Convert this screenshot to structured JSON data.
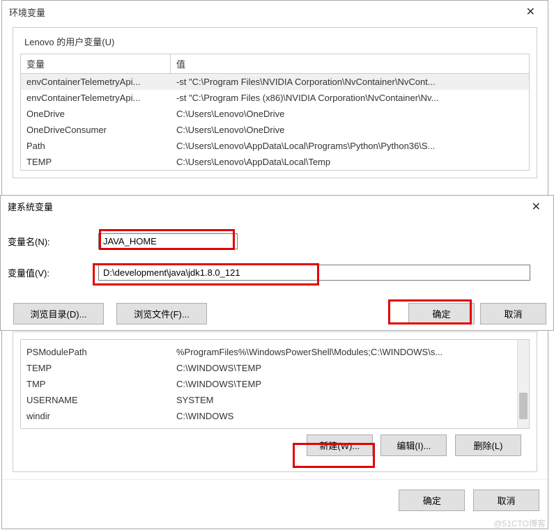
{
  "envDialog": {
    "title": "环境变量",
    "userGroup": "Lenovo 的用户变量(U)",
    "colVar": "变量",
    "colVal": "值",
    "userVars": [
      {
        "name": "envContainerTelemetryApi...",
        "value": "-st \"C:\\Program Files\\NVIDIA Corporation\\NvContainer\\NvCont..."
      },
      {
        "name": "envContainerTelemetryApi...",
        "value": "-st \"C:\\Program Files (x86)\\NVIDIA Corporation\\NvContainer\\Nv..."
      },
      {
        "name": "OneDrive",
        "value": "C:\\Users\\Lenovo\\OneDrive"
      },
      {
        "name": "OneDriveConsumer",
        "value": "C:\\Users\\Lenovo\\OneDrive"
      },
      {
        "name": "Path",
        "value": "C:\\Users\\Lenovo\\AppData\\Local\\Programs\\Python\\Python36\\S..."
      },
      {
        "name": "TEMP",
        "value": "C:\\Users\\Lenovo\\AppData\\Local\\Temp"
      }
    ],
    "sysVars": [
      {
        "name": "PSModulePath",
        "value": "%ProgramFiles%\\WindowsPowerShell\\Modules;C:\\WINDOWS\\s..."
      },
      {
        "name": "TEMP",
        "value": "C:\\WINDOWS\\TEMP"
      },
      {
        "name": "TMP",
        "value": "C:\\WINDOWS\\TEMP"
      },
      {
        "name": "USERNAME",
        "value": "SYSTEM"
      },
      {
        "name": "windir",
        "value": "C:\\WINDOWS"
      }
    ],
    "btnNew": "新建(W)...",
    "btnEdit": "编辑(I)...",
    "btnDelete": "删除(L)",
    "btnOk": "确定",
    "btnCancel": "取消"
  },
  "newDialog": {
    "title": "建系统变量",
    "labelName": "变量名(N):",
    "labelValue": "变量值(V):",
    "btnBrowseDir": "浏览目录(D)...",
    "btnBrowseFile": "浏览文件(F)...",
    "btnOk": "确定",
    "btnCancel": "取消",
    "valueName": "JAVA_HOME",
    "valueVal": "D:\\development\\java\\jdk1.8.0_121"
  },
  "watermark": "@51CTO博客"
}
